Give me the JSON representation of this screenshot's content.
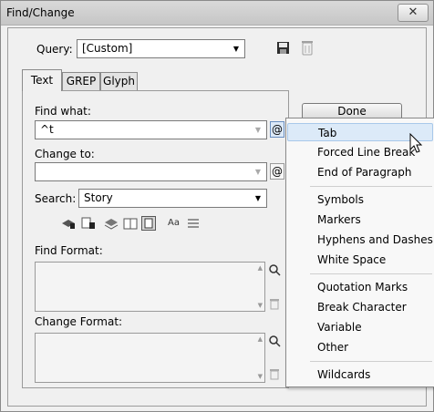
{
  "window": {
    "title": "Find/Change",
    "close_glyph": "✕"
  },
  "query": {
    "label": "Query:",
    "value": "[Custom]"
  },
  "tabs": [
    {
      "label": "Text"
    },
    {
      "label": "GREP"
    },
    {
      "label": "Glyph"
    }
  ],
  "find": {
    "label": "Find what:",
    "value": "^t"
  },
  "change": {
    "label": "Change to:",
    "value": ""
  },
  "search": {
    "label": "Search:",
    "value": "Story"
  },
  "find_format": {
    "label": "Find Format:"
  },
  "change_format": {
    "label": "Change Format:"
  },
  "done_label": "Done",
  "special_char_glyph": "@",
  "option_icons": [
    "Aa"
  ],
  "menu": {
    "items": [
      "Tab",
      "Forced Line Break",
      "End of Paragraph",
      "Symbols",
      "Markers",
      "Hyphens and Dashes",
      "White Space",
      "Quotation Marks",
      "Break Character",
      "Variable",
      "Other",
      "Wildcards"
    ]
  }
}
